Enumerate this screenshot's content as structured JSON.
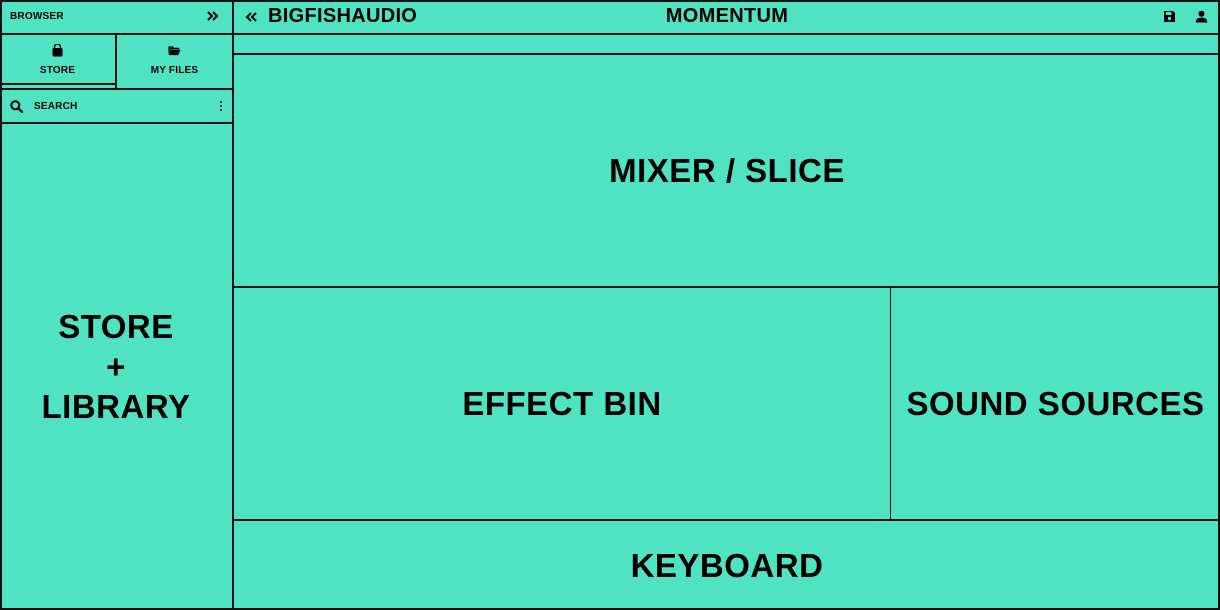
{
  "colors": {
    "background": "#50e3c2",
    "border": "#111111",
    "text": "#000000"
  },
  "sidebar": {
    "header": {
      "title": "BROWSER",
      "collapse_icon": "double-chevron-right-icon"
    },
    "tabs": [
      {
        "label": "STORE",
        "icon": "shopping-bag-icon",
        "active": true
      },
      {
        "label": "MY FILES",
        "icon": "folder-open-icon",
        "active": false
      }
    ],
    "search": {
      "label": "SEARCH",
      "icon": "search-icon",
      "menu_icon": "more-vertical-icon"
    },
    "content": {
      "line1": "STORE",
      "line2": "+",
      "line3": "LIBRARY"
    }
  },
  "topbar": {
    "back_icon": "double-chevron-left-icon",
    "brand": "BIGFISHAUDIO",
    "title": "MOMENTUM",
    "save_icon": "save-icon",
    "user_icon": "user-icon"
  },
  "panels": {
    "mixer": "MIXER / SLICE",
    "effect_bin": "EFFECT BIN",
    "sound_sources": "SOUND SOURCES",
    "keyboard": "KEYBOARD"
  }
}
